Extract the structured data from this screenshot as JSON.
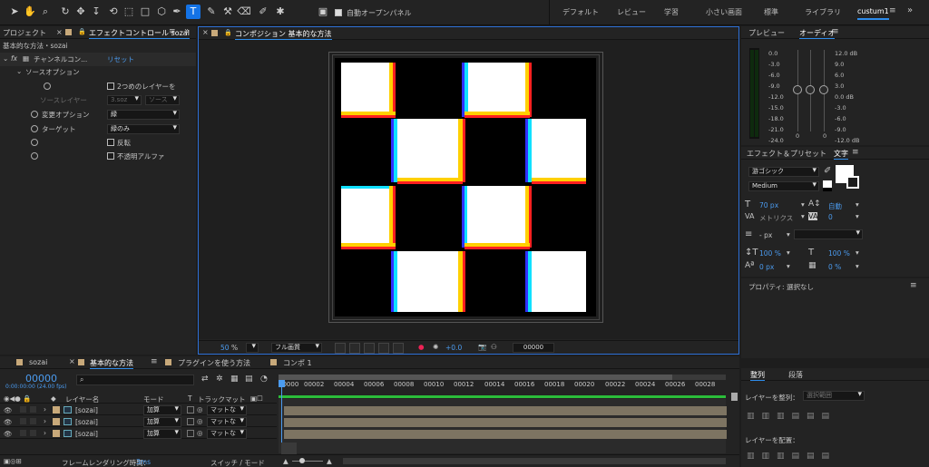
{
  "toolbar": {
    "auto_open_label": "自動オープンパネル",
    "workspaces": [
      "デフォルト",
      "レビュー",
      "学習",
      "小さい画面",
      "標準",
      "ライブラリ",
      "custum1"
    ]
  },
  "project_panel": {
    "tab_label": "プロジェクト"
  },
  "effect_controls": {
    "tab_label": "エフェクトコントロール sozai",
    "breadcrumb": "基本的な方法・sozai",
    "effect_name": "チャンネルコン...",
    "reset": "リセット",
    "source_options": "ソースオプション",
    "use_second_layer": "2つめのレイヤーを",
    "source_layer_label": "ソースレイヤー",
    "source_layer_value": "3.soz",
    "source_layer_value2": "ソース",
    "change_option_label": "変更オプション",
    "change_option_value": "緑",
    "target_label": "ターゲット",
    "target_value": "緑のみ",
    "invert_label": "反転",
    "opaque_alpha_label": "不透明アルファ"
  },
  "composition": {
    "tab_label": "コンポジション 基本的な方法",
    "zoom": "50",
    "zoom_unit": "%",
    "resolution": "フル画質",
    "exposure": "+0.0",
    "timecode": "00000"
  },
  "audio_panel": {
    "preview_tab": "プレビュー",
    "audio_tab": "オーディオ",
    "left_scale": [
      "0.0",
      "-3.0",
      "-6.0",
      "-9.0",
      "-12.0",
      "-15.0",
      "-18.0",
      "-21.0",
      "-24.0"
    ],
    "right_scale": [
      "12.0 dB",
      "9.0",
      "6.0",
      "3.0",
      "0.0 dB",
      "-3.0",
      "-6.0",
      "-9.0",
      "-12.0 dB"
    ],
    "slider_values": [
      "0",
      "0"
    ]
  },
  "effects_presets": {
    "tab_label": "エフェクト＆プリセット"
  },
  "character_panel": {
    "tab_label": "文字",
    "font_family": "游ゴシック",
    "font_style": "Medium",
    "font_size": "70 px",
    "leading": "自動",
    "kerning": "メトリクス",
    "tracking": "0",
    "stroke_width": "- px",
    "vertical_scale": "100 %",
    "horizontal_scale": "100 %",
    "baseline_shift": "0 px",
    "tsume": "0 %"
  },
  "properties_panel": {
    "title": "プロパティ: 選択なし"
  },
  "timeline": {
    "tabs": [
      "sozai",
      "基本的な方法",
      "プラグインを使う方法",
      "コンポ 1"
    ],
    "timecode": "00000",
    "fps_label": "0:00:00:00 (24.00 fps)",
    "col_layer_name": "レイヤー名",
    "col_mode": "モード",
    "col_t": "T",
    "col_trackmatte": "トラックマット",
    "ruler": [
      "00000",
      "00002",
      "00004",
      "00006",
      "00008",
      "00010",
      "00012",
      "00014",
      "00016",
      "00018",
      "00020",
      "00022",
      "00024",
      "00026",
      "00028"
    ],
    "layers": [
      {
        "name": "[sozai]",
        "mode": "加算",
        "matte": "マットな"
      },
      {
        "name": "[sozai]",
        "mode": "加算",
        "matte": "マットな"
      },
      {
        "name": "[sozai]",
        "mode": "加算",
        "matte": "マットな"
      }
    ],
    "render_time_label": "フレームレンダリング時間：",
    "render_time_value": "3ms",
    "switch_mode": "スイッチ / モード"
  },
  "align_panel": {
    "tab_align": "整列",
    "tab_paragraph": "段落",
    "align_layers_to": "レイヤーを整列：",
    "align_to_value": "選択範囲",
    "distribute_layers": "レイヤーを配置："
  }
}
